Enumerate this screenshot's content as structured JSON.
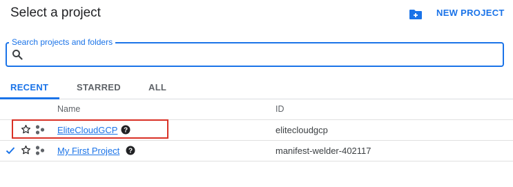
{
  "dialog": {
    "title": "Select a project",
    "new_project_label": "NEW PROJECT"
  },
  "search": {
    "label": "Search projects and folders",
    "value": "",
    "placeholder": ""
  },
  "tabs": [
    {
      "label": "RECENT",
      "active": true
    },
    {
      "label": "STARRED",
      "active": false
    },
    {
      "label": "ALL",
      "active": false
    }
  ],
  "table": {
    "columns": [
      "Name",
      "ID"
    ],
    "rows": [
      {
        "name": "EliteCloudGCP",
        "id": "elitecloudgcp",
        "selected": false,
        "highlighted": true
      },
      {
        "name": "My First Project",
        "id": "manifest-welder-402117",
        "selected": true,
        "highlighted": false
      }
    ]
  },
  "colors": {
    "accent": "#1a73e8",
    "highlight": "#d93025",
    "muted_text": "#5f6368"
  }
}
